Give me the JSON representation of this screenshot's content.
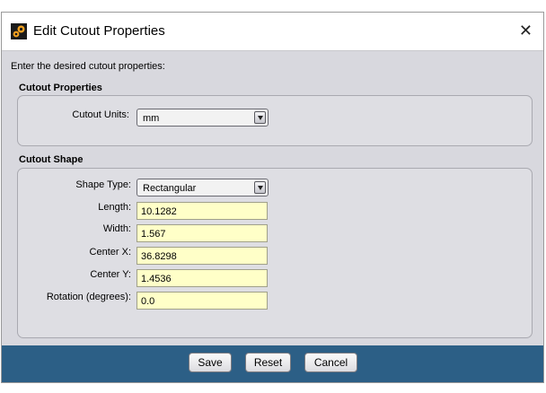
{
  "window": {
    "title": "Edit Cutout Properties",
    "close_glyph": "✕",
    "icon": "gears-icon"
  },
  "prompt": "Enter the desired cutout properties:",
  "properties": {
    "heading": "Cutout Properties",
    "units_label": "Cutout Units:",
    "units_value": "mm"
  },
  "shape": {
    "heading": "Cutout Shape",
    "type_label": "Shape Type:",
    "type_value": "Rectangular",
    "fields": [
      {
        "label": "Length:",
        "value": "10.1282"
      },
      {
        "label": "Width:",
        "value": "1.567"
      },
      {
        "label": "Center X:",
        "value": "36.8298"
      },
      {
        "label": "Center Y:",
        "value": "1.4536"
      },
      {
        "label": "Rotation (degrees):",
        "value": "0.0"
      }
    ]
  },
  "buttons": {
    "save": "Save",
    "reset": "Reset",
    "cancel": "Cancel"
  },
  "colors": {
    "footer": "#2c5f86",
    "field_bg": "#ffffc8",
    "panel_bg": "#d8d8de"
  }
}
